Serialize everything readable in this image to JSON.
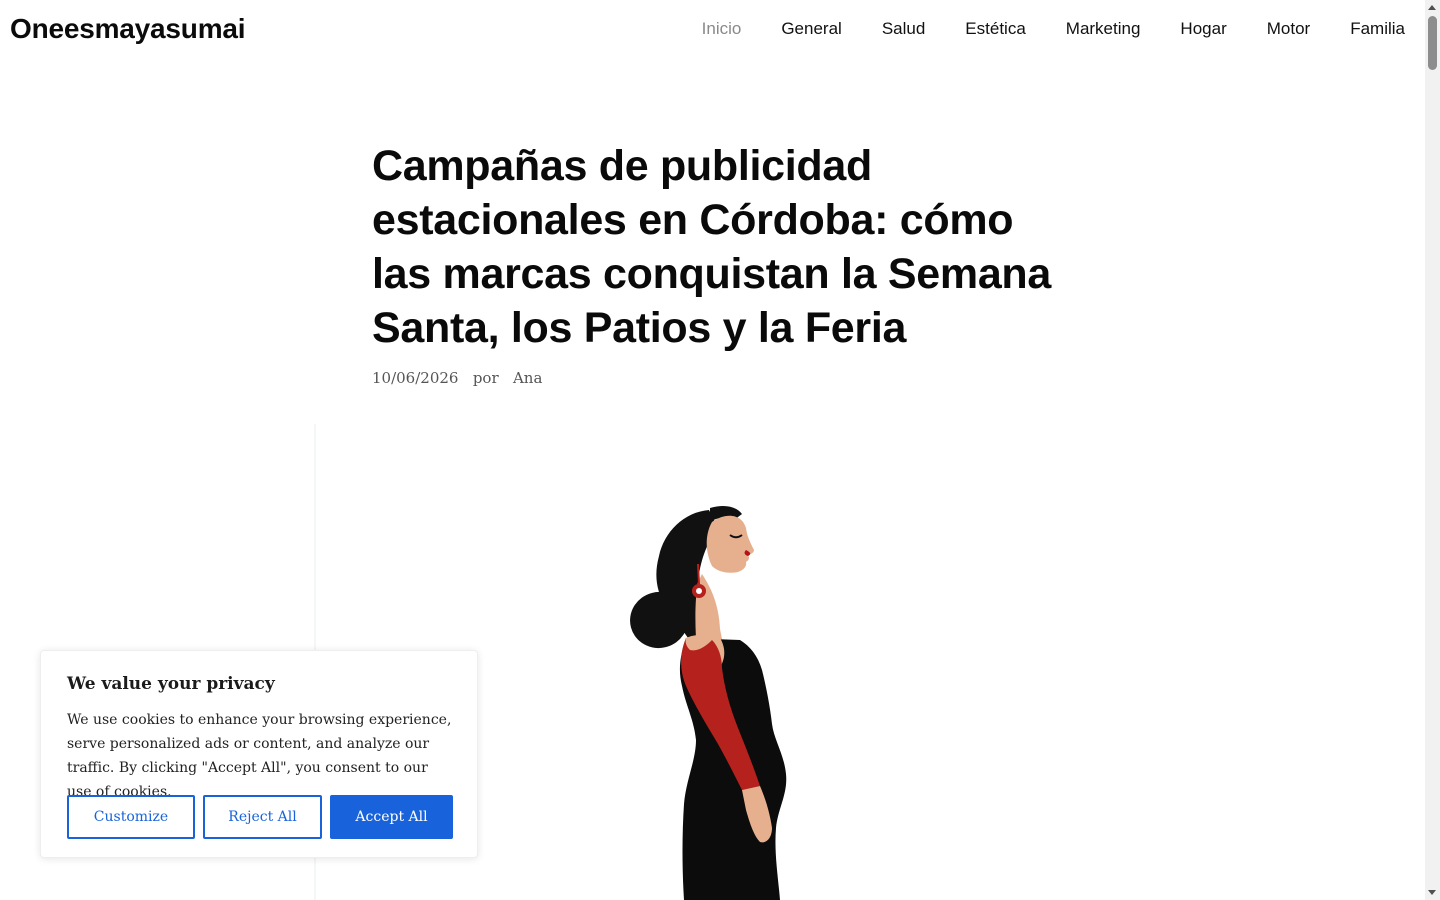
{
  "site": {
    "title": "Oneesmayasumai"
  },
  "nav": {
    "items": [
      {
        "label": "Inicio",
        "active": true
      },
      {
        "label": "General"
      },
      {
        "label": "Salud"
      },
      {
        "label": "Estética"
      },
      {
        "label": "Marketing"
      },
      {
        "label": "Hogar"
      },
      {
        "label": "Motor"
      },
      {
        "label": "Familia"
      }
    ]
  },
  "article": {
    "title": "Campañas de publicidad estacionales en Córdoba: cómo las marcas conquistan la Semana Santa, los Patios y la Feria",
    "date": "10/06/2026",
    "by": "por",
    "author": "Ana",
    "image_icon": "flamenco-woman-illustration",
    "colors": {
      "hair": "#111111",
      "skin": "#e6b08f",
      "dress": "#0c0c0c",
      "sleeve": "#b5221e",
      "lips": "#b3121a"
    }
  },
  "cookie_banner": {
    "title": "We value your privacy",
    "text": "We use cookies to enhance your browsing experience, serve personalized ads or content, and analyze our traffic. By clicking \"Accept All\", you consent to our use of cookies.",
    "customize_label": "Customize",
    "reject_label": "Reject All",
    "accept_label": "Accept All",
    "accent_color": "#1863dc"
  }
}
